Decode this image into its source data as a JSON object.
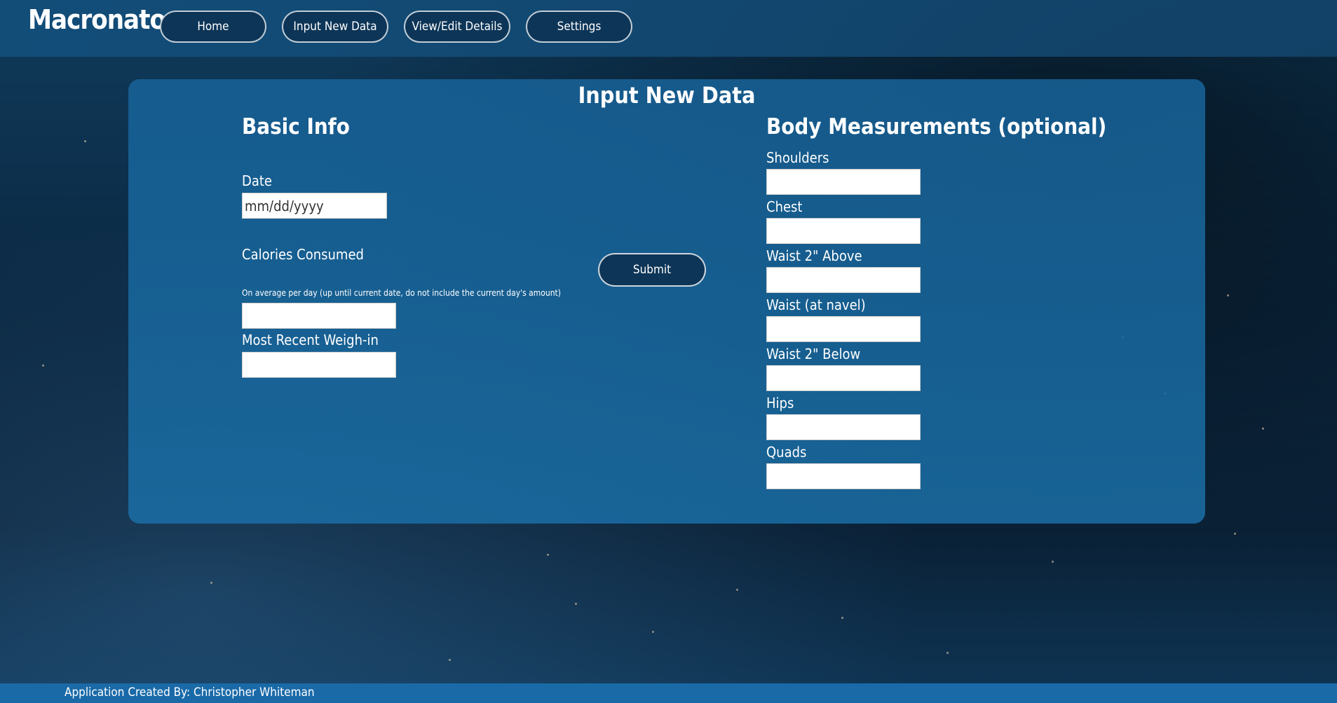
{
  "app": {
    "brand": "Macronator"
  },
  "nav": {
    "home": "Home",
    "input_new_data": "Input New Data",
    "view_edit_details": "View/Edit Details",
    "settings": "Settings"
  },
  "page": {
    "title": "Input New Data"
  },
  "basic_info": {
    "title": "Basic Info",
    "date_label": "Date",
    "date_placeholder": "mm/dd/yyyy",
    "calories_label": "Calories Consumed",
    "calories_help": "On average per day (up until current date, do not include the current day's amount)",
    "weigh_in_label": "Most Recent Weigh-in"
  },
  "submit": {
    "label": "Submit"
  },
  "body_measurements": {
    "title": "Body Measurements (optional)",
    "shoulders": "Shoulders",
    "chest": "Chest",
    "waist_above": "Waist 2\" Above",
    "waist_navel": "Waist (at navel)",
    "waist_below": "Waist 2\" Below",
    "hips": "Hips",
    "quads": "Quads"
  },
  "footer": {
    "text": "Application Created By: Christopher Whiteman"
  },
  "colors": {
    "topbar": "#124e7a",
    "card": "#1a6ea6",
    "button": "#0d3557",
    "footer": "#1a6aa8"
  }
}
